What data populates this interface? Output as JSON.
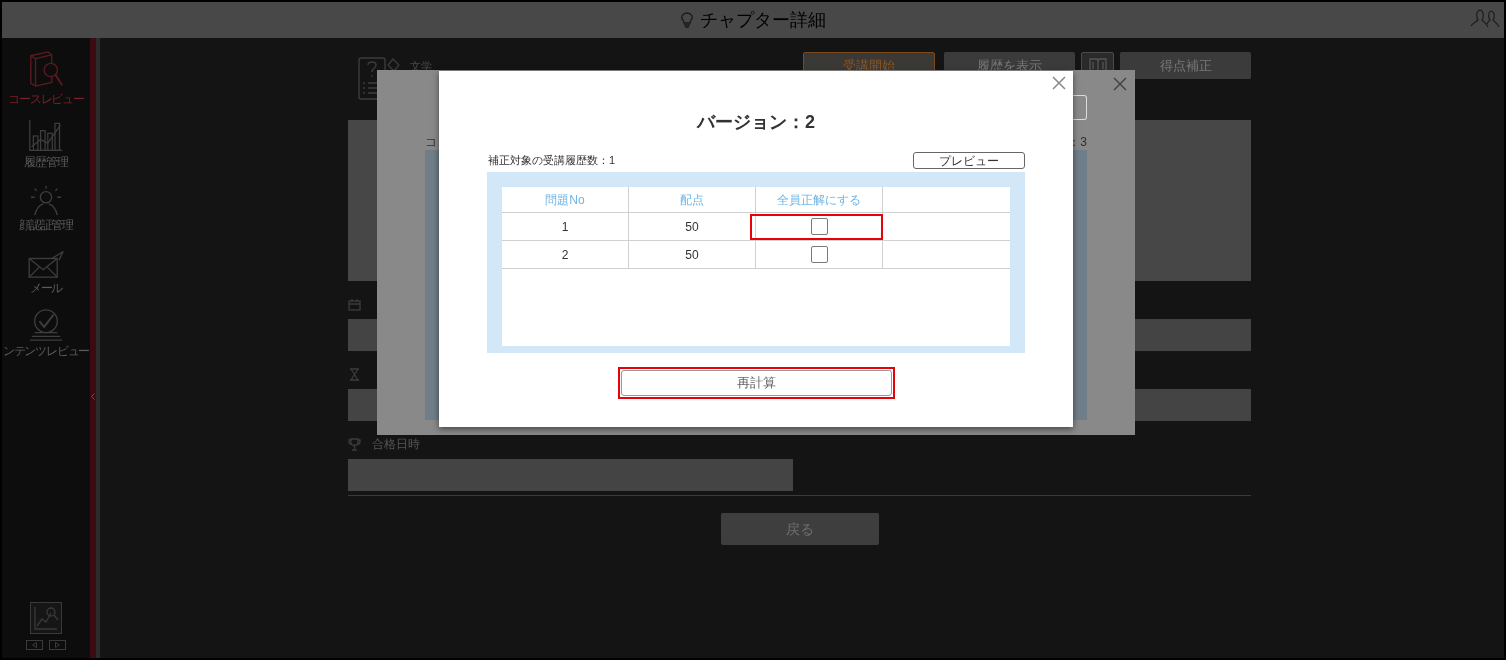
{
  "header": {
    "title": "チャプター詳細"
  },
  "sidebar": {
    "items": [
      {
        "label": "コースレビュー",
        "kind": "course-review",
        "selected": true
      },
      {
        "label": "履歴管理",
        "kind": "history",
        "selected": false
      },
      {
        "label": "顔認証管理",
        "kind": "face-auth",
        "selected": false
      },
      {
        "label": "メール",
        "kind": "mail",
        "selected": false
      },
      {
        "label": "ンテンツレビュー",
        "kind": "content-review",
        "selected": false
      }
    ]
  },
  "chapter": {
    "category": "文学",
    "buttons": [
      {
        "kind": "primary",
        "label": "受講開始"
      },
      {
        "kind": "default",
        "label": "履歴を表示"
      },
      {
        "kind": "icon"
      },
      {
        "kind": "default",
        "label": "得点補正"
      }
    ]
  },
  "form": {
    "fields": [
      {
        "kind": "date"
      },
      {
        "kind": "duration"
      },
      {
        "kind": "pass-date",
        "label": "合格日時"
      }
    ],
    "back_button": "戻る"
  },
  "score_dialog": {
    "left_text": "コ",
    "right_text": "：3"
  },
  "version_dialog": {
    "title": "バージョン：2",
    "count_label": "補正対象の受講履歴数：1",
    "preview_button": "プレビュー",
    "table": {
      "columns": [
        "問題No",
        "配点",
        "全員正解にする"
      ],
      "rows": [
        {
          "no": "1",
          "points": "50",
          "all_correct": false,
          "highlighted": true
        },
        {
          "no": "2",
          "points": "50",
          "all_correct": false,
          "highlighted": false
        }
      ]
    },
    "recalculate_button": {
      "label": "再計算",
      "highlighted": true
    }
  }
}
